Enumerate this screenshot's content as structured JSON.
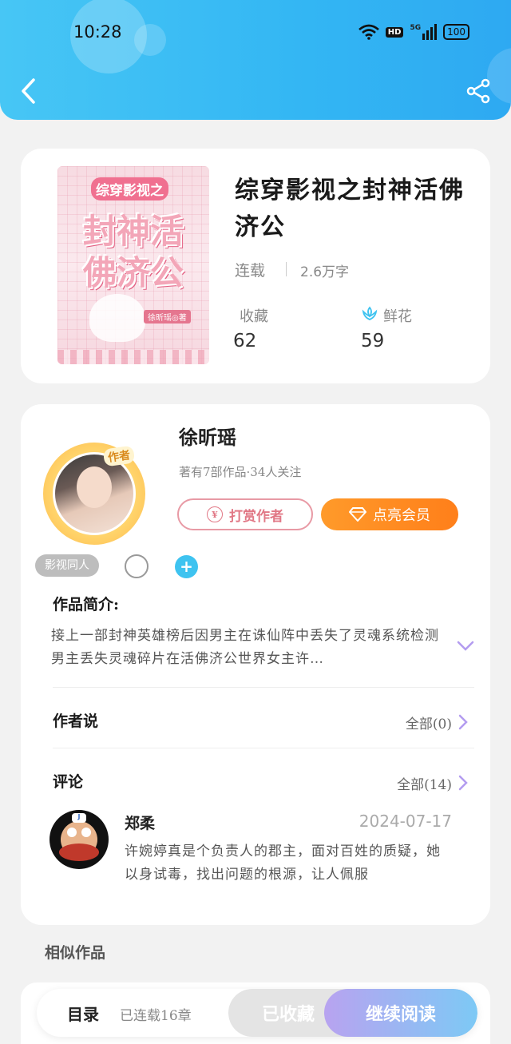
{
  "status_bar": {
    "time": "10:28",
    "network": "5G",
    "hd": "HD",
    "battery": "100"
  },
  "book": {
    "cover_subtitle": "综穿影视之",
    "cover_title_line1": "封神活",
    "cover_title_line2": "佛济公",
    "cover_author_tag": "徐昕瑶◎著",
    "title": "综穿影视之封神活佛济公",
    "status": "连载",
    "word_count": "2.6万字",
    "favorites_label": "收藏",
    "favorites_value": "62",
    "flowers_label": "鲜花",
    "flowers_value": "59"
  },
  "author": {
    "badge": "作者",
    "name": "徐昕瑶",
    "meta": "著有7部作品·34人关注",
    "tip_button": "打赏作者",
    "tip_coin": "¥",
    "vip_button": "点亮会员"
  },
  "tags": {
    "chip": "影视同人",
    "add": "+"
  },
  "intro": {
    "title": "作品简介:",
    "text": "接上一部封神英雄榜后因男主在诛仙阵中丢失了灵魂系统检测男主丢失灵魂碎片在活佛济公世界女主许…"
  },
  "author_says": {
    "title": "作者说",
    "more": "全部(0)"
  },
  "comments": {
    "title": "评论",
    "more": "全部(14)",
    "items": [
      {
        "name": "郑柔",
        "date": "2024-07-17",
        "text": "许婉婷真是个负责人的郡主，面对百姓的质疑，她以身试毒，找出问题的根源，让人佩服"
      }
    ]
  },
  "similar": {
    "title": "相似作品"
  },
  "bottom_bar": {
    "toc": "目录",
    "chapters": "已连载16章",
    "saved": "已收藏",
    "read": "继续阅读"
  },
  "colors": {
    "header_blue": "#33b6f3",
    "vip_orange": "#ff8a1f",
    "tip_pink": "#e17886",
    "accent_purple": "#b39cf0"
  }
}
